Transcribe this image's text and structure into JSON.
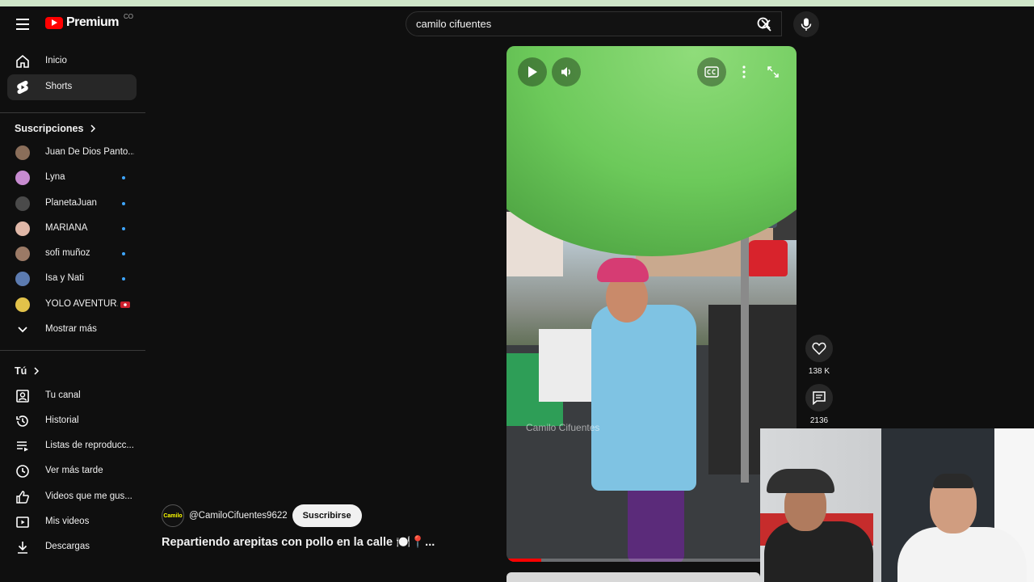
{
  "header": {
    "logo_text": "Premium",
    "logo_country": "CO",
    "search_value": "camilo cifuentes"
  },
  "sidebar": {
    "main": [
      {
        "label": "Inicio",
        "icon": "home-icon"
      },
      {
        "label": "Shorts",
        "icon": "shorts-icon",
        "active": true
      }
    ],
    "subscriptions_title": "Suscripciones",
    "subscriptions": [
      {
        "label": "Juan De Dios Panto...",
        "avatar_color": "#8a6e5a",
        "dot": false
      },
      {
        "label": "Lyna",
        "avatar_color": "#c78bd0",
        "dot": true
      },
      {
        "label": "PlanetaJuan",
        "avatar_color": "#4a4a4a",
        "dot": true
      },
      {
        "label": "MARIANA",
        "avatar_color": "#e0b8a8",
        "dot": true
      },
      {
        "label": "sofi muñoz",
        "avatar_color": "#9b7a66",
        "dot": true
      },
      {
        "label": "Isa y Nati",
        "avatar_color": "#5c7bb0",
        "dot": true
      },
      {
        "label": "YOLO AVENTUR...",
        "avatar_color": "#e2c24a",
        "live": true
      }
    ],
    "show_more": "Mostrar más",
    "you_title": "Tú",
    "you": [
      {
        "label": "Tu canal",
        "icon": "channel-icon"
      },
      {
        "label": "Historial",
        "icon": "history-icon"
      },
      {
        "label": "Listas de reproducc...",
        "icon": "playlists-icon"
      },
      {
        "label": "Ver más tarde",
        "icon": "watch-later-icon"
      },
      {
        "label": "Videos que me gus...",
        "icon": "like-icon"
      },
      {
        "label": "Mis videos",
        "icon": "my-videos-icon"
      },
      {
        "label": "Descargas",
        "icon": "downloads-icon"
      }
    ]
  },
  "video": {
    "watermark": "Camilo Cifuentes",
    "progress": 0.12
  },
  "actions": {
    "likes": "138 K",
    "comments": "2136"
  },
  "channel": {
    "handle": "@CamiloCifuentes9622",
    "subscribe_label": "Suscribirse",
    "avatar_text": "Camilo"
  },
  "title": "Repartiendo arepitas con pollo en la calle 🍽️📍..."
}
